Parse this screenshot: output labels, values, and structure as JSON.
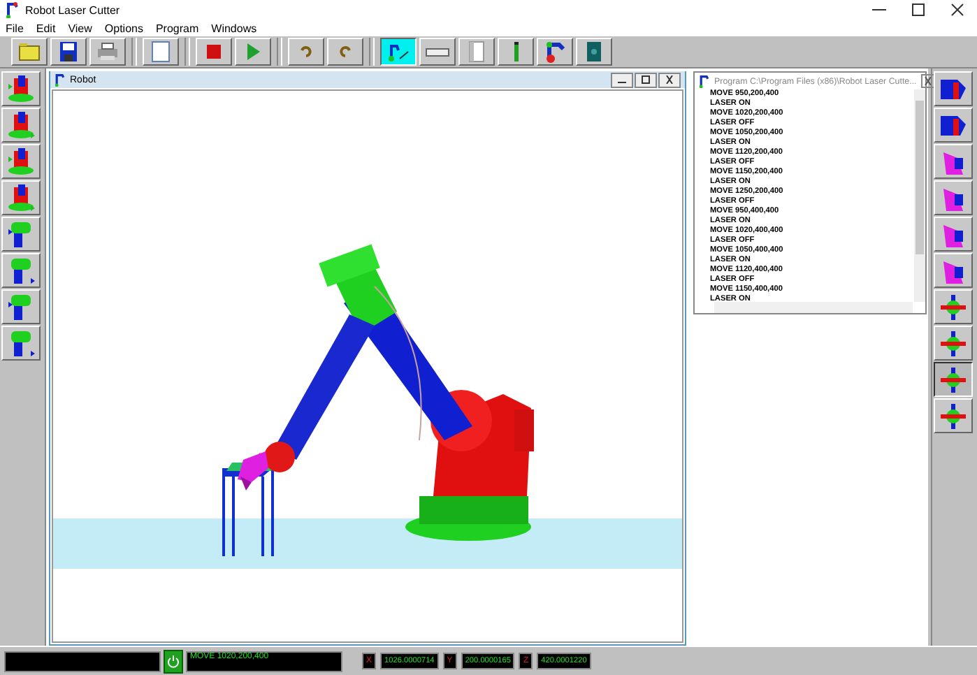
{
  "window": {
    "title": "Robot Laser Cutter"
  },
  "menu": [
    "File",
    "Edit",
    "View",
    "Options",
    "Program",
    "Windows"
  ],
  "toolbar": [
    {
      "selected": false
    },
    {
      "selected": false
    },
    {
      "selected": false
    },
    {
      "selected": false
    },
    {
      "selected": false
    },
    {
      "selected": false
    },
    {
      "selected": false
    },
    {
      "selected": false
    },
    {
      "selected": true
    },
    {
      "selected": false
    },
    {
      "selected": false
    },
    {
      "selected": false
    },
    {
      "selected": false
    },
    {
      "selected": false
    }
  ],
  "left_palette": [
    {
      "selected": false
    },
    {
      "selected": false
    },
    {
      "selected": false
    },
    {
      "selected": false
    },
    {
      "selected": false
    },
    {
      "selected": false
    },
    {
      "selected": false
    },
    {
      "selected": false
    }
  ],
  "robot_window": {
    "title": "Robot"
  },
  "program_window": {
    "title": "Program C:\\Program Files (x86)\\Robot Laser Cutte...",
    "lines": [
      "MOVE 950,200,400",
      "LASER ON",
      "MOVE 1020,200,400",
      "LASER OFF",
      "MOVE 1050,200,400",
      "LASER ON",
      "MOVE 1120,200,400",
      "LASER OFF",
      "MOVE 1150,200,400",
      "LASER ON",
      "MOVE 1250,200,400",
      "LASER OFF",
      "MOVE 950,400,400",
      "LASER ON",
      "MOVE 1020,400,400",
      "LASER OFF",
      "MOVE 1050,400,400",
      "LASER ON",
      "MOVE 1120,400,400",
      "LASER OFF",
      "MOVE 1150,400,400",
      "LASER ON"
    ]
  },
  "right_palette": [
    {
      "selected": false
    },
    {
      "selected": false
    },
    {
      "selected": false
    },
    {
      "selected": false
    },
    {
      "selected": false
    },
    {
      "selected": false
    },
    {
      "selected": false
    },
    {
      "selected": false
    },
    {
      "selected": true
    },
    {
      "selected": false
    }
  ],
  "status_bar": {
    "current_line": "MOVE 1020,200,400",
    "coords": [
      {
        "label": "X",
        "value": "1026.0000714"
      },
      {
        "label": "Y",
        "value": "200.0000165"
      },
      {
        "label": "Z",
        "value": "420.0001220"
      }
    ]
  }
}
